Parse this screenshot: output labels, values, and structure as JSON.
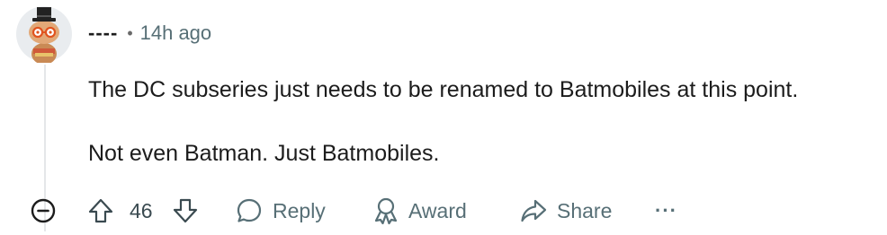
{
  "comment": {
    "username": "----",
    "separator": "•",
    "time": "14h ago",
    "paragraphs": [
      "The DC subseries just needs to be renamed to Batmobiles at this point.",
      "Not even Batman. Just Batmobiles."
    ],
    "vote_count": "46"
  },
  "actions": {
    "reply": "Reply",
    "award": "Award",
    "share": "Share",
    "more": "···"
  },
  "icons": {
    "avatar": "snoo-avatar-icon",
    "collapse": "minus-circle-icon",
    "upvote": "arrow-up-icon",
    "downvote": "arrow-down-icon",
    "reply": "speech-bubble-icon",
    "award": "award-ribbon-icon",
    "share": "share-arrow-icon"
  },
  "colors": {
    "text": "#1c1c1c",
    "meta": "#576f76",
    "thread_line": "#e5e7e9"
  }
}
